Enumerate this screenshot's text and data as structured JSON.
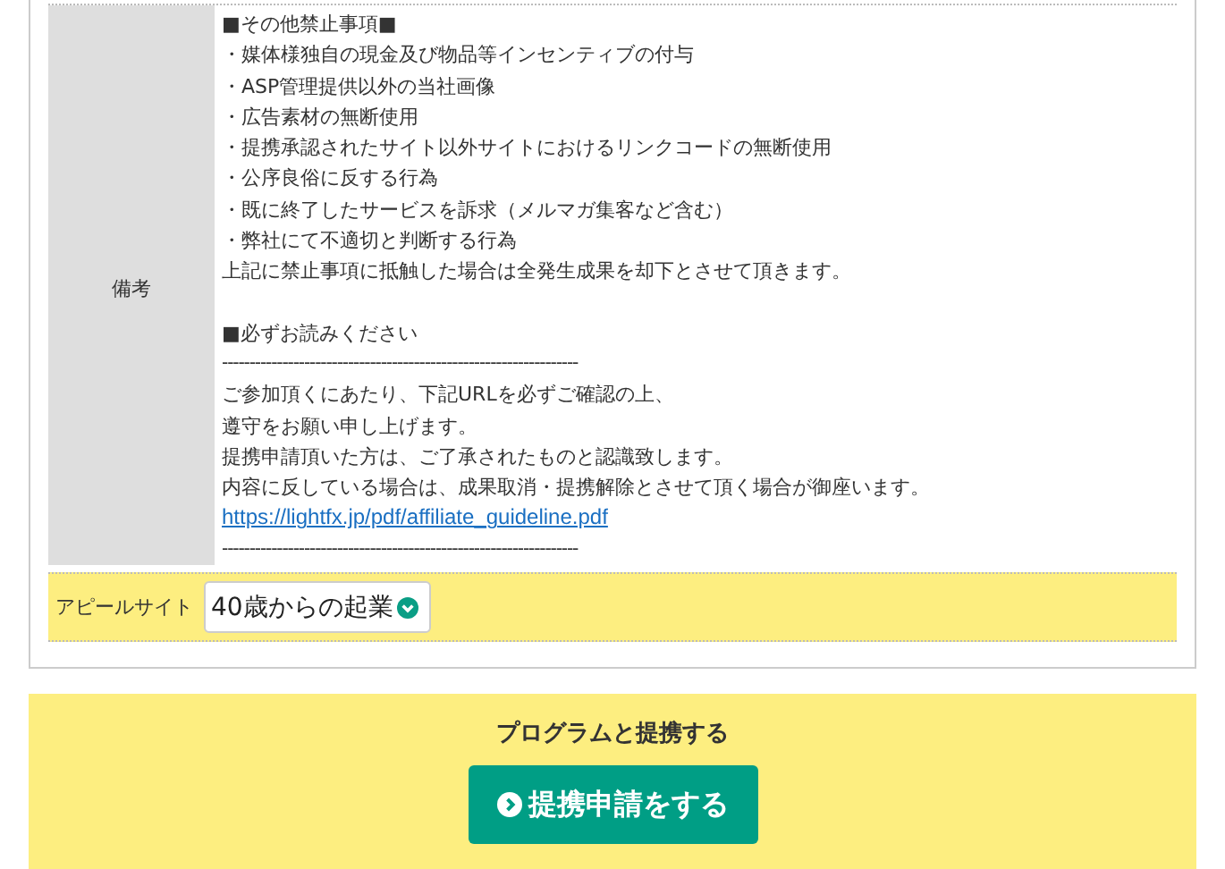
{
  "remarks": {
    "label": "備考",
    "blocks": [
      {
        "lines": [
          {
            "kind": "text",
            "text": "■その他禁止事項■"
          },
          {
            "kind": "text",
            "text": "・媒体様独自の現金及び物品等インセンティブの付与"
          },
          {
            "kind": "text",
            "text": "・ASP管理提供以外の当社画像"
          },
          {
            "kind": "text",
            "text": "・広告素材の無断使用"
          },
          {
            "kind": "text",
            "text": "・提携承認されたサイト以外サイトにおけるリンクコードの無断使用"
          },
          {
            "kind": "text",
            "text": "・公序良俗に反する行為"
          },
          {
            "kind": "text",
            "text": "・既に終了したサービスを訴求（メルマガ集客など含む）"
          },
          {
            "kind": "text",
            "text": "・弊社にて不適切と判断する行為"
          },
          {
            "kind": "text",
            "text": "上記に禁止事項に抵触した場合は全発生成果を却下とさせて頂きます。"
          }
        ]
      },
      {
        "lines": [
          {
            "kind": "text",
            "text": "■必ずお読みください"
          },
          {
            "kind": "rule",
            "text": "-----------------------------------------------------------------"
          },
          {
            "kind": "text",
            "text": "ご参加頂くにあたり、下記URLを必ずご確認の上、"
          },
          {
            "kind": "text",
            "text": "遵守をお願い申し上げます。"
          },
          {
            "kind": "text",
            "text": "提携申請頂いた方は、ご了承されたものと認識致します。"
          },
          {
            "kind": "text",
            "text": "内容に反している場合は、成果取消・提携解除とさせて頂く場合が御座います。"
          },
          {
            "kind": "link",
            "text": "https://lightfx.jp/pdf/affiliate_guideline.pdf"
          },
          {
            "kind": "rule",
            "text": "-----------------------------------------------------------------"
          }
        ]
      }
    ]
  },
  "appeal_site": {
    "label": "アピールサイト",
    "value": "40歳からの起業"
  },
  "cta": {
    "title": "プログラムと提携する",
    "button": "提携申請をする"
  }
}
